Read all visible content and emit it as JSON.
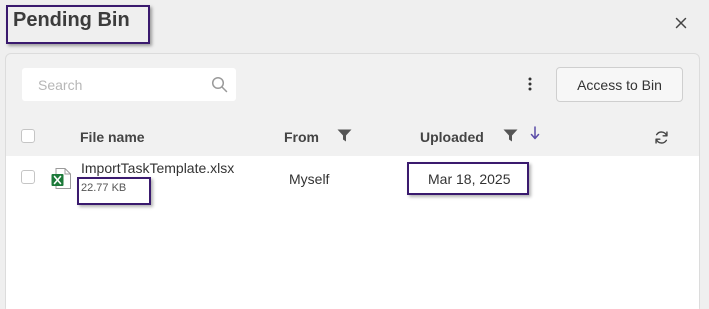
{
  "dialog": {
    "title": "Pending Bin"
  },
  "toolbar": {
    "search_placeholder": "Search",
    "access_button_label": "Access to Bin"
  },
  "table": {
    "columns": [
      "File name",
      "From",
      "Uploaded"
    ],
    "sort": {
      "column": "Uploaded",
      "direction": "descending"
    },
    "rows": [
      {
        "file_name": "ImportTaskTemplate.xlsx",
        "file_size": "22.77 KB",
        "from": "Myself",
        "uploaded": "Mar 18, 2025",
        "file_icon": "excel-file-icon"
      }
    ]
  },
  "colors": {
    "highlight_border": "#3a1a6e",
    "sort_arrow": "#5b4ca8",
    "excel_green": "#1d7a3a"
  }
}
